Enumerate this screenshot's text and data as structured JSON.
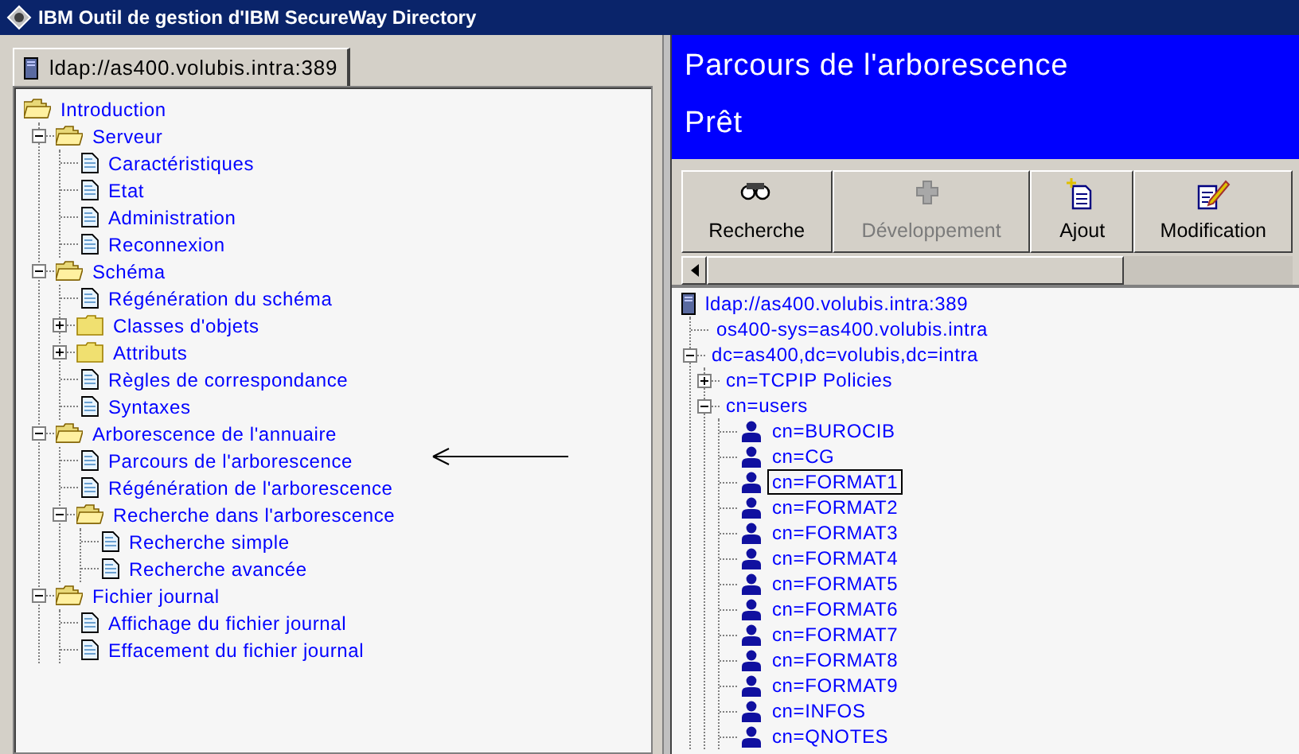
{
  "window": {
    "title": "IBM Outil de gestion d'IBM SecureWay Directory"
  },
  "left_pane": {
    "tab": {
      "label": "ldap://as400.volubis.intra:389",
      "selected": true
    },
    "tree": [
      {
        "kind": "folder",
        "label": "Introduction",
        "children": [
          {
            "kind": "folder",
            "label": "Serveur",
            "expanded": true,
            "children": [
              {
                "kind": "page",
                "label": "Caractéristiques"
              },
              {
                "kind": "page",
                "label": "Etat"
              },
              {
                "kind": "page",
                "label": "Administration"
              },
              {
                "kind": "page",
                "label": "Reconnexion"
              }
            ]
          },
          {
            "kind": "folder",
            "label": "Schéma",
            "expanded": true,
            "children": [
              {
                "kind": "page",
                "label": "Régénération du schéma"
              },
              {
                "kind": "folder",
                "label": "Classes d'objets",
                "expanded": false
              },
              {
                "kind": "folder",
                "label": "Attributs",
                "expanded": false
              },
              {
                "kind": "page",
                "label": "Règles de correspondance"
              },
              {
                "kind": "page",
                "label": "Syntaxes"
              }
            ]
          },
          {
            "kind": "folder",
            "label": "Arborescence de l'annuaire",
            "expanded": true,
            "children": [
              {
                "kind": "page",
                "label": "Parcours de l'arborescence"
              },
              {
                "kind": "page",
                "label": "Régénération de l'arborescence"
              },
              {
                "kind": "folder",
                "label": "Recherche dans l'arborescence",
                "expanded": true,
                "children": [
                  {
                    "kind": "page",
                    "label": "Recherche simple"
                  },
                  {
                    "kind": "page",
                    "label": "Recherche avancée"
                  }
                ]
              }
            ]
          },
          {
            "kind": "folder",
            "label": "Fichier journal",
            "expanded": true,
            "children": [
              {
                "kind": "page",
                "label": "Affichage du fichier journal"
              },
              {
                "kind": "page",
                "label": "Effacement du fichier journal"
              }
            ]
          }
        ]
      }
    ]
  },
  "right_pane": {
    "header": {
      "title": "Parcours de l'arborescence",
      "status": "Prêt"
    },
    "toolbar": [
      {
        "kind": "search",
        "label": "Recherche",
        "disabled": false
      },
      {
        "kind": "expand",
        "label": "Développement",
        "disabled": true
      },
      {
        "kind": "add",
        "label": "Ajout",
        "disabled": false
      },
      {
        "kind": "edit",
        "label": "Modification",
        "disabled": false
      }
    ],
    "tree": [
      {
        "kind": "server",
        "label": "ldap://as400.volubis.intra:389",
        "selected": false,
        "children": [
          {
            "label": "os400-sys=as400.volubis.intra",
            "selected": false
          },
          {
            "label": "dc=as400,dc=volubis,dc=intra",
            "selected": false,
            "expanded": true,
            "children": [
              {
                "label": "cn=TCPIP Policies",
                "selected": false,
                "expanded": false
              },
              {
                "label": "cn=users",
                "selected": false,
                "expanded": true,
                "children": [
                  {
                    "kind": "person",
                    "label": "cn=BUROCIB",
                    "selected": false
                  },
                  {
                    "kind": "person",
                    "label": "cn=CG",
                    "selected": false
                  },
                  {
                    "kind": "person",
                    "label": "cn=FORMAT1",
                    "selected": true
                  },
                  {
                    "kind": "person",
                    "label": "cn=FORMAT2",
                    "selected": false
                  },
                  {
                    "kind": "person",
                    "label": "cn=FORMAT3",
                    "selected": false
                  },
                  {
                    "kind": "person",
                    "label": "cn=FORMAT4",
                    "selected": false
                  },
                  {
                    "kind": "person",
                    "label": "cn=FORMAT5",
                    "selected": false
                  },
                  {
                    "kind": "person",
                    "label": "cn=FORMAT6",
                    "selected": false
                  },
                  {
                    "kind": "person",
                    "label": "cn=FORMAT7",
                    "selected": false
                  },
                  {
                    "kind": "person",
                    "label": "cn=FORMAT8",
                    "selected": false
                  },
                  {
                    "kind": "person",
                    "label": "cn=FORMAT9",
                    "selected": false
                  },
                  {
                    "kind": "person",
                    "label": "cn=INFOS",
                    "selected": false
                  },
                  {
                    "kind": "person",
                    "label": "cn=QNOTES",
                    "selected": false
                  }
                ]
              }
            ]
          }
        ]
      }
    ]
  }
}
